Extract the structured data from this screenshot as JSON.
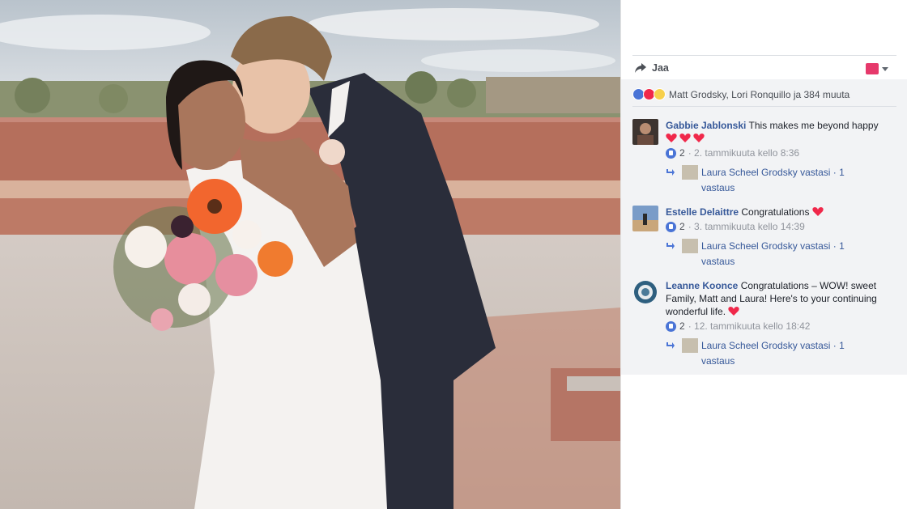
{
  "share": {
    "label": "Jaa",
    "icon": "share-arrow-icon",
    "badge_color": "#e6396b"
  },
  "reactions": {
    "icons": [
      "like-icon",
      "love-icon",
      "wow-icon"
    ],
    "text": "Matt Grodsky, Lori Ronquillo ja 384 muuta"
  },
  "comments": [
    {
      "name": "Gabbie Jablonski",
      "text": "This makes me beyond happy",
      "hearts": 3,
      "likes": "2",
      "time": "· 2. tammikuuta kello 8:36",
      "reply": "Laura Scheel Grodsky vastasi · 1 vastaus"
    },
    {
      "name": "Estelle Delaittre",
      "text": "Congratulations",
      "hearts": 1,
      "likes": "2",
      "time": "· 3. tammikuuta kello 14:39",
      "reply": "Laura Scheel Grodsky vastasi · 1 vastaus"
    },
    {
      "name": "Leanne Koonce",
      "text": "Congratulations – WOW! sweet Family, Matt and Laura! Here's to your continuing wonderful life.",
      "hearts": 1,
      "likes": "2",
      "time": "· 12. tammikuuta kello 18:42",
      "reply": "Laura Scheel Grodsky vastasi · 1 vastaus"
    }
  ],
  "colors": {
    "link": "#365899",
    "meta": "#90949c",
    "panel_bg": "#f2f3f5",
    "heart": "#f0284a"
  }
}
